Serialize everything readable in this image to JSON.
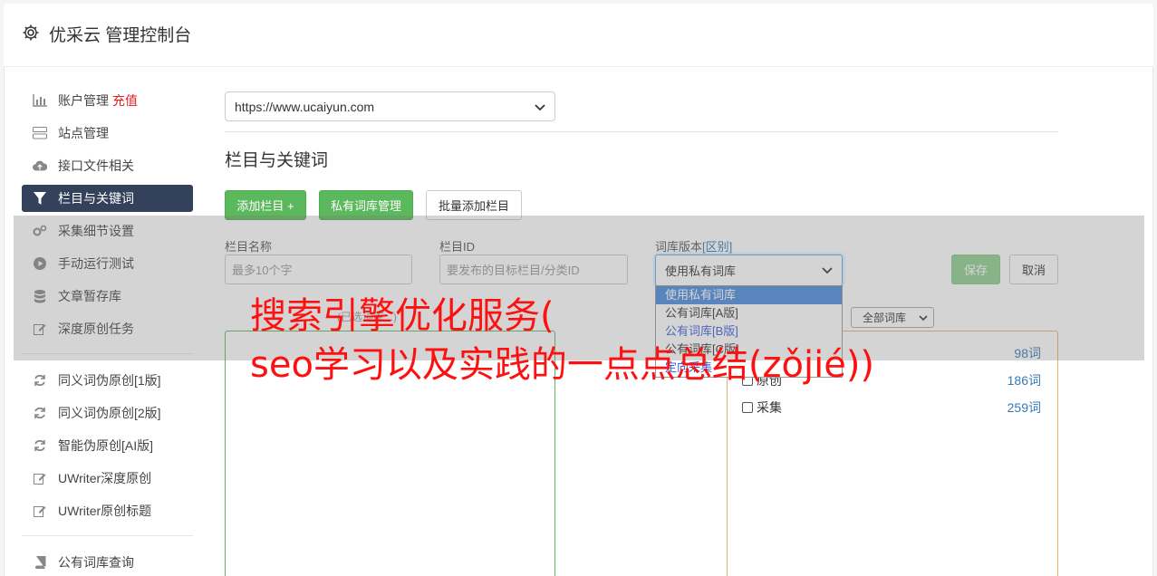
{
  "header": {
    "title": "优采云 管理控制台"
  },
  "sidebar": {
    "items": [
      {
        "label": "账户管理",
        "badge": "充值",
        "icon": "bar-chart-icon"
      },
      {
        "label": "站点管理",
        "icon": "server-icon"
      },
      {
        "label": "接口文件相关",
        "icon": "cloud-upload-icon"
      },
      {
        "label": "栏目与关键词",
        "icon": "filter-icon",
        "active": true
      },
      {
        "label": "采集细节设置",
        "icon": "gears-icon"
      },
      {
        "label": "手动运行测试",
        "icon": "play-circle-icon"
      },
      {
        "label": "文章暂存库",
        "icon": "database-icon"
      },
      {
        "label": "深度原创任务",
        "icon": "edit-icon"
      }
    ],
    "items2": [
      {
        "label": "同义词伪原创[1版]",
        "icon": "refresh-icon"
      },
      {
        "label": "同义词伪原创[2版]",
        "icon": "refresh-icon"
      },
      {
        "label": "智能伪原创[AI版]",
        "icon": "refresh-icon"
      },
      {
        "label": "UWriter深度原创",
        "icon": "edit-icon"
      },
      {
        "label": "UWriter原创标题",
        "icon": "edit-icon"
      }
    ],
    "items3": [
      {
        "label": "公有词库查询",
        "icon": "book-icon"
      }
    ]
  },
  "main": {
    "site_select": "https://www.ucaiyun.com",
    "section_title": "栏目与关键词",
    "buttons": {
      "add_column": "添加栏目 +",
      "private_lib": "私有词库管理",
      "batch_add": "批量添加栏目",
      "save": "保存",
      "cancel": "取消"
    },
    "form": {
      "col_name_label": "栏目名称",
      "col_name_placeholder": "最多10个字",
      "col_id_label": "栏目ID",
      "col_id_placeholder": "要发布的目标栏目/分类ID",
      "lib_version_label": "词库版本",
      "lib_version_link": "[区别]",
      "lib_version_value": "使用私有词库",
      "lib_version_options": [
        "使用私有词库",
        "公有词库[A版]",
        "公有词库[B版]",
        "公有词库[C版]",
        "定向采集"
      ]
    },
    "filter_hint": "(已选词库...)",
    "filter_select": "全部词库",
    "libraries": [
      {
        "label": "",
        "count": "98词"
      },
      {
        "label": "原创",
        "count": "186词"
      },
      {
        "label": "采集",
        "count": "259词"
      }
    ]
  },
  "overlay": {
    "line1": "搜索引擎优化服务(",
    "line2": "seo学习以及实践的一点点总结(zǒjié))"
  }
}
